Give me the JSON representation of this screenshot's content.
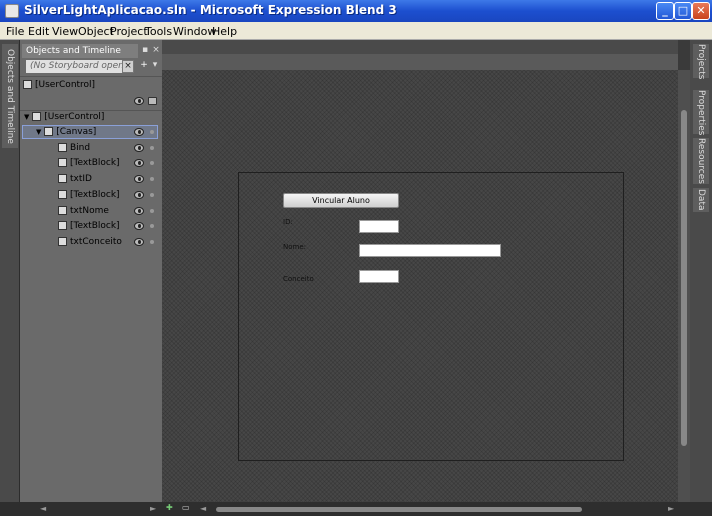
{
  "window": {
    "title": "SilverLightAplicacao.sln - Microsoft Expression Blend 3",
    "buttons": {
      "minimize": "_",
      "maximize": "□",
      "close": "✕"
    }
  },
  "menu": [
    "File",
    "Edit",
    "View",
    "Object",
    "Project",
    "Tools",
    "Window",
    "Help"
  ],
  "left_strip": {
    "tab": "Objects and Timeline"
  },
  "objects_panel": {
    "tab_title": "Objects and Timeline",
    "storyboard_placeholder": "(No Storyboard open)",
    "root": "[UserControl]",
    "tree": [
      {
        "label": "[UserControl]",
        "depth": 0
      },
      {
        "label": "[Canvas]",
        "depth": 1
      },
      {
        "label": "Bind",
        "depth": 2
      },
      {
        "label": "[TextBlock]",
        "depth": 2
      },
      {
        "label": "txtID",
        "depth": 2
      },
      {
        "label": "[TextBlock]",
        "depth": 2
      },
      {
        "label": "txtNome",
        "depth": 2
      },
      {
        "label": "[TextBlock]",
        "depth": 2
      },
      {
        "label": "txtConceito",
        "depth": 2
      }
    ]
  },
  "design": {
    "button_label": "Vincular Aluno",
    "labels": {
      "id": "ID:",
      "nome": "Nome:",
      "conceito": "Conceito"
    }
  },
  "right_strip": {
    "tabs": [
      "Projects",
      "Properties",
      "Resources",
      "Data"
    ]
  }
}
